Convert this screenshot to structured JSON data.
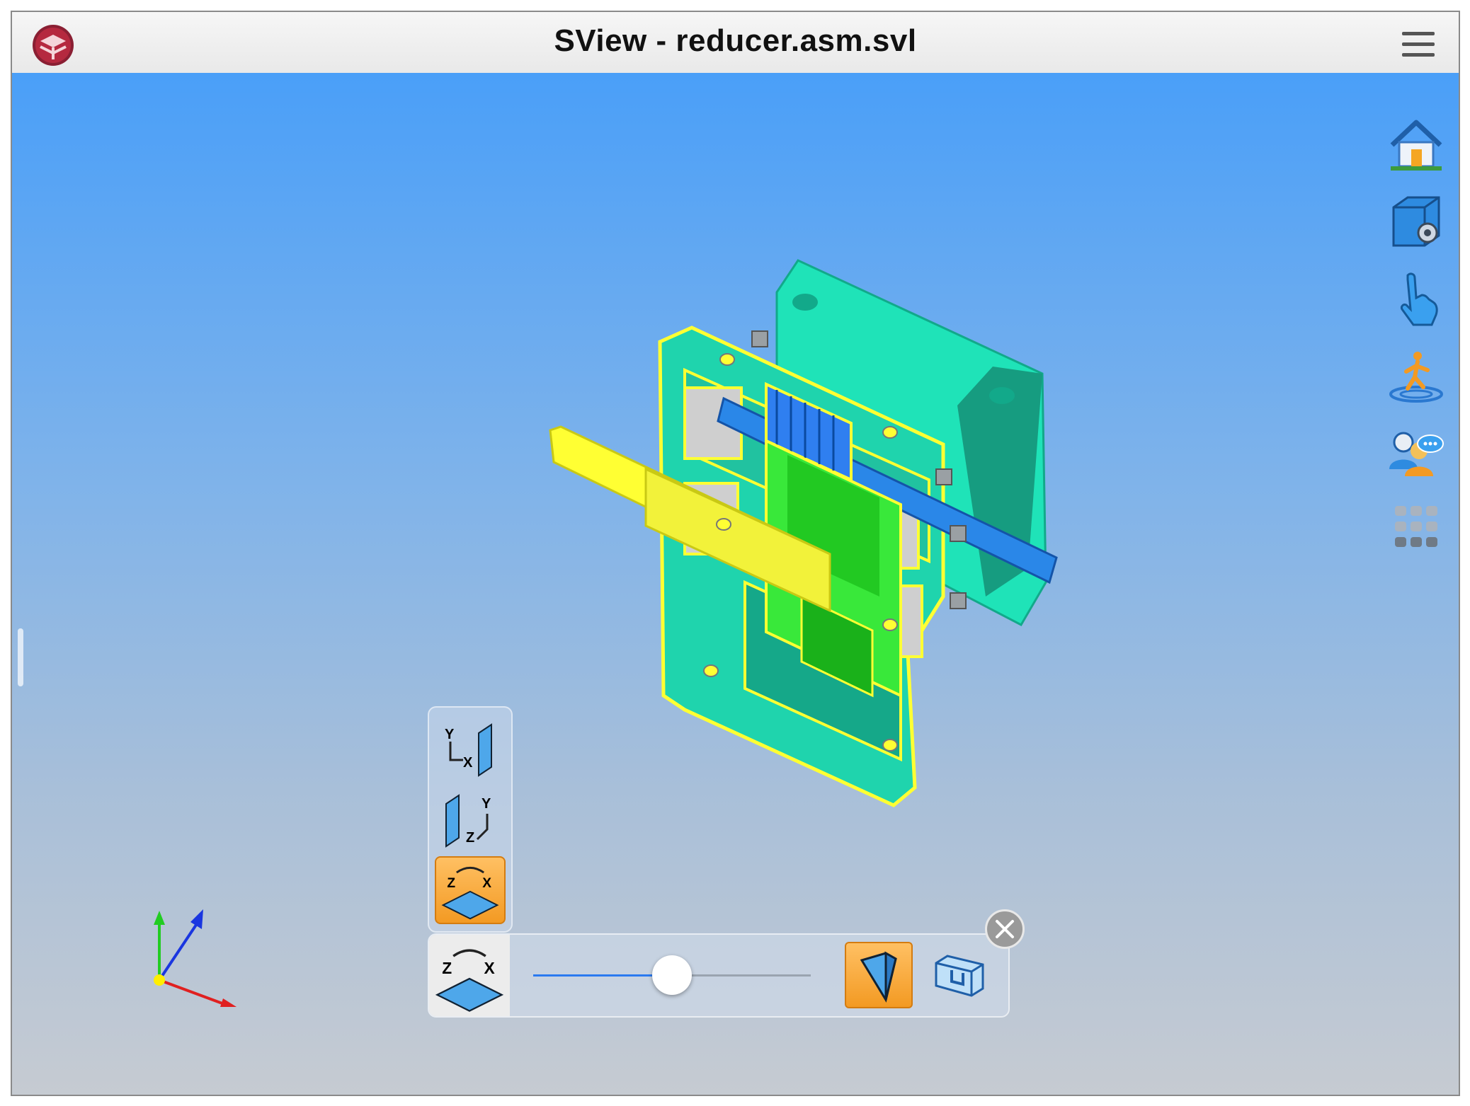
{
  "window": {
    "title": "SView - reducer.asm.svl",
    "logo_icon": "sview-logo-icon",
    "menu_icon": "hamburger-menu-icon"
  },
  "sidebar": {
    "items": [
      {
        "name": "home",
        "icon": "house-icon"
      },
      {
        "name": "view-settings",
        "icon": "cube-gear-icon"
      },
      {
        "name": "touch-gesture",
        "icon": "pointing-hand-icon"
      },
      {
        "name": "walkthrough",
        "icon": "walking-person-icon"
      },
      {
        "name": "collaboration",
        "icon": "users-chat-icon"
      },
      {
        "name": "more-apps",
        "icon": "grid-icon"
      }
    ]
  },
  "section_tool": {
    "plane_buttons": [
      {
        "plane": "XY",
        "axes": [
          "Y",
          "X"
        ],
        "active": false
      },
      {
        "plane": "YZ",
        "axes": [
          "Z",
          "Y"
        ],
        "active": false
      },
      {
        "plane": "ZX",
        "axes": [
          "Z",
          "X"
        ],
        "active": true
      }
    ],
    "current_plane_axes": [
      "Z",
      "X"
    ],
    "slider_fraction": 0.5,
    "clip_solid_active": true
  },
  "colors": {
    "accent": "#f39a23",
    "viewport_top": "#4a9ff8",
    "viewport_bottom": "#c6cbd2",
    "housing": "#1fe3b8",
    "section_outline": "#ffff33"
  }
}
